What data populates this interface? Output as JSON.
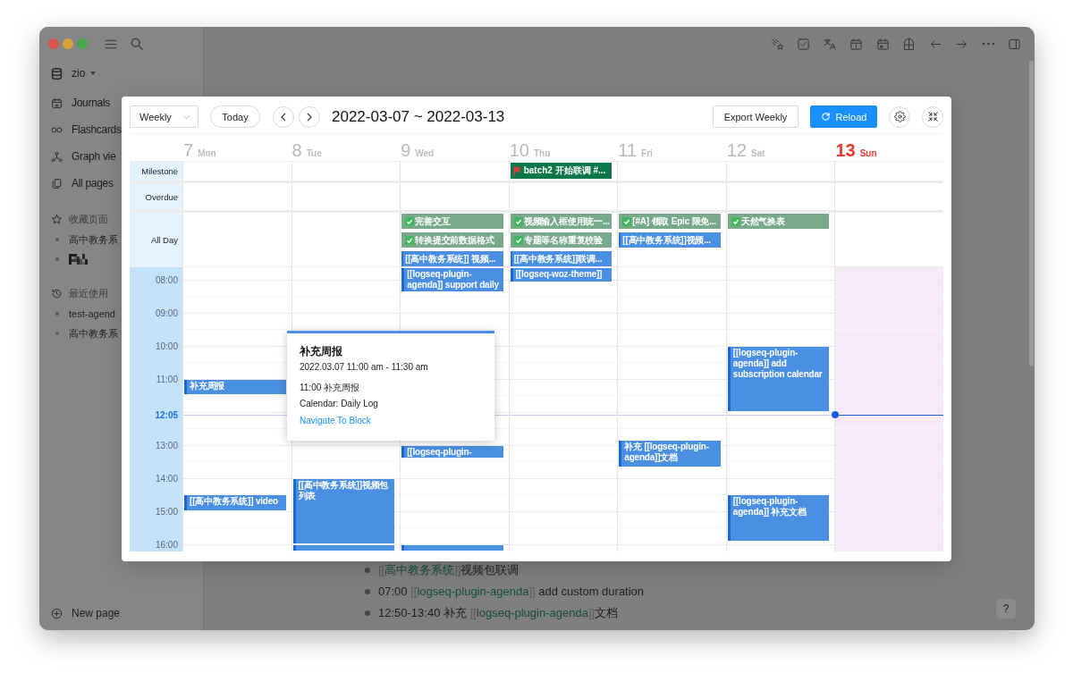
{
  "sidebar": {
    "graph": "zio",
    "nav": [
      "Journals",
      "Flashcards",
      "Graph vie",
      "All pages"
    ],
    "favorites": {
      "title": "收藏页面",
      "items": [
        {
          "kind": "page",
          "label": "高中教务系"
        },
        {
          "kind": "redacted"
        }
      ]
    },
    "recent": {
      "title": "最近使用",
      "items": [
        "test-agend",
        "高中教务系"
      ]
    },
    "new_page": "New page"
  },
  "blocks": [
    {
      "segments": [
        {
          "kind": "bracket",
          "text": "[["
        },
        {
          "kind": "link",
          "text": "高中教务系统"
        },
        {
          "kind": "bracket",
          "text": "]]"
        },
        {
          "kind": "text",
          "text": "视频包联调"
        }
      ]
    },
    {
      "segments": [
        {
          "kind": "text",
          "text": "07:00 "
        },
        {
          "kind": "bracket",
          "text": "[["
        },
        {
          "kind": "link",
          "text": "logseq-plugin-agenda"
        },
        {
          "kind": "bracket",
          "text": "]]"
        },
        {
          "kind": "text",
          "text": " add custom duration"
        }
      ]
    },
    {
      "segments": [
        {
          "kind": "text",
          "text": "12:50-13:40 补充 "
        },
        {
          "kind": "bracket",
          "text": "[["
        },
        {
          "kind": "link",
          "text": "logseq-plugin-agenda"
        },
        {
          "kind": "bracket",
          "text": "]]"
        },
        {
          "kind": "text",
          "text": "文档"
        }
      ]
    }
  ],
  "help_button": "?",
  "agenda": {
    "view_select": "Weekly",
    "today_button": "Today",
    "range_title": "2022-03-07 ~ 2022-03-13",
    "export_button": "Export Weekly",
    "reload_button": "Reload",
    "row_labels": {
      "milestone": "Milestone",
      "overdue": "Overdue",
      "all_day": "All Day"
    },
    "time_labels": [
      "08:00",
      "09:00",
      "10:00",
      "11:00",
      "13:00",
      "14:00",
      "15:00",
      "16:00"
    ],
    "now_label": "12:05",
    "days": [
      {
        "number": "7",
        "weekday": "Mon",
        "today": false,
        "events": [
          {
            "kind": "event",
            "title": "补充周报"
          },
          {
            "kind": "event",
            "title": "[[高中教务系统]] video"
          }
        ]
      },
      {
        "number": "8",
        "weekday": "Tue",
        "today": false,
        "events": [
          {
            "kind": "event",
            "title": "[[高中教务系统]]视频包列表"
          },
          {
            "kind": "cut-off"
          }
        ]
      },
      {
        "number": "9",
        "weekday": "Wed",
        "today": false,
        "all_day": [
          {
            "title": "完善交互",
            "done": true
          },
          {
            "title": "转换提交前数据格式",
            "done": true
          },
          {
            "title": "[[高中教务系统]] 视频...",
            "done": false
          }
        ],
        "events": [
          {
            "kind": "event",
            "title": "[[logseq-plugin-agenda]] support daily"
          },
          {
            "kind": "event",
            "title": "[[logseq-plugin-"
          },
          {
            "kind": "cut-off"
          }
        ]
      },
      {
        "number": "10",
        "weekday": "Thu",
        "today": false,
        "milestones": [
          {
            "title": "batch2 开始联调 #..."
          }
        ],
        "all_day": [
          {
            "title": "视频输入框使用统一...",
            "done": true
          },
          {
            "title": "专题等名称重复校验",
            "done": true
          },
          {
            "title": "[[高中教务系统]]联调...",
            "done": false
          }
        ],
        "events": [
          {
            "kind": "event",
            "title": "[[logseq-woz-theme]]"
          }
        ]
      },
      {
        "number": "11",
        "weekday": "Fri",
        "today": false,
        "all_day": [
          {
            "title": "[#A] 领取 Epic 限免...",
            "done": true
          },
          {
            "title": "[[高中教务系统]]视频...",
            "done": false
          }
        ],
        "events": [
          {
            "kind": "event",
            "title": "补充 [[logseq-plugin-agenda]]文档"
          }
        ]
      },
      {
        "number": "12",
        "weekday": "Sat",
        "today": false,
        "all_day": [
          {
            "title": "天然气换表",
            "done": true
          }
        ],
        "events": [
          {
            "kind": "event",
            "title": "[[logseq-plugin-agenda]] add subscription calendar"
          },
          {
            "kind": "event",
            "title": "[[logseq-plugin-agenda]] 补充文档"
          }
        ]
      },
      {
        "number": "13",
        "weekday": "Sun",
        "today": true
      }
    ],
    "popup": {
      "title": "补充周报",
      "time": "2022.03.07 11:00 am - 11:30 am",
      "detail": "11:00 补充周报",
      "calendar": "Calendar: Daily Log",
      "link": "Navigate To Block"
    }
  }
}
